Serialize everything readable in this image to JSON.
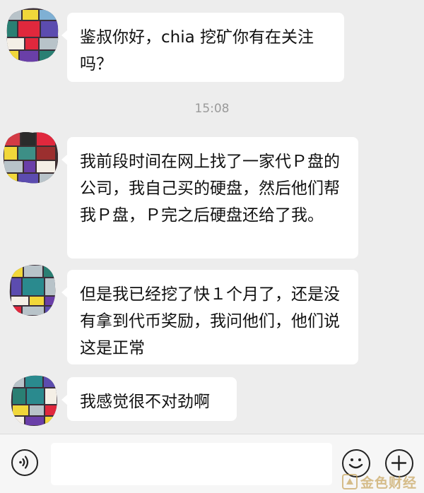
{
  "colors": {
    "background": "#ededed",
    "bubble": "#ffffff",
    "text": "#111111",
    "timestamp": "#9a9a9a",
    "watermark": "#c8a45c"
  },
  "messages": [
    {
      "text": "鉴叔你好，chia 挖矿你有在关注吗？"
    },
    {
      "text": "我前段时间在网上找了一家代Ｐ盘的公司，我自己买的硬盘，然后他们帮我Ｐ盘，Ｐ完之后硬盘还给了我。"
    },
    {
      "text": "但是我已经挖了快１个月了，还是没有拿到代币奖励，我问他们，他们说这是正常"
    },
    {
      "text": "我感觉很不对劲啊"
    }
  ],
  "timestamp": "15:08",
  "input_bar": {
    "input_value": "",
    "voice_icon": "voice-icon",
    "emoji_icon": "emoji-icon",
    "plus_icon": "plus-icon"
  },
  "watermark": {
    "text": "金色财经"
  }
}
